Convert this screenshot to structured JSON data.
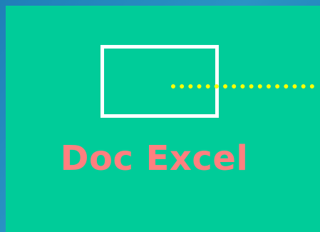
{
  "slide": {
    "label": "Doc Excel"
  },
  "colors": {
    "background_outer": "#1f7fb8",
    "panel": "#00cc99",
    "box_border": "#ffffff",
    "dotted_line": "#ffff00",
    "label_text": "#ff7f7f"
  }
}
